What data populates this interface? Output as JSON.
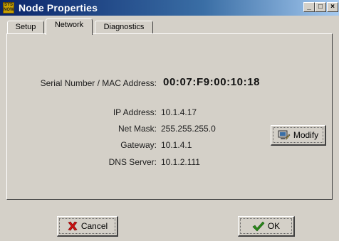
{
  "window": {
    "title": "Node Properties",
    "app_icon_text": "SYS NOW"
  },
  "tabs": [
    {
      "label": "Setup",
      "active": false
    },
    {
      "label": "Network",
      "active": true
    },
    {
      "label": "Diagnostics",
      "active": false
    }
  ],
  "network": {
    "serial_label": "Serial Number / MAC Address:",
    "serial_value": "00:07:F9:00:10:18",
    "ip_label": "IP Address:",
    "ip_value": "10.1.4.17",
    "mask_label": "Net Mask:",
    "mask_value": "255.255.255.0",
    "gateway_label": "Gateway:",
    "gateway_value": "10.1.4.1",
    "dns_label": "DNS Server:",
    "dns_value": "10.1.2.111",
    "modify_label": "Modify"
  },
  "footer": {
    "cancel_label": "Cancel",
    "ok_label": "OK"
  },
  "icons": {
    "cancel": "x-icon",
    "ok": "checkmark-icon",
    "modify": "computer-edit-icon"
  },
  "colors": {
    "titlebar_start": "#0a246a",
    "titlebar_end": "#a6caf0",
    "cancel_icon": "#cc1111",
    "ok_icon": "#2a8a1a"
  }
}
